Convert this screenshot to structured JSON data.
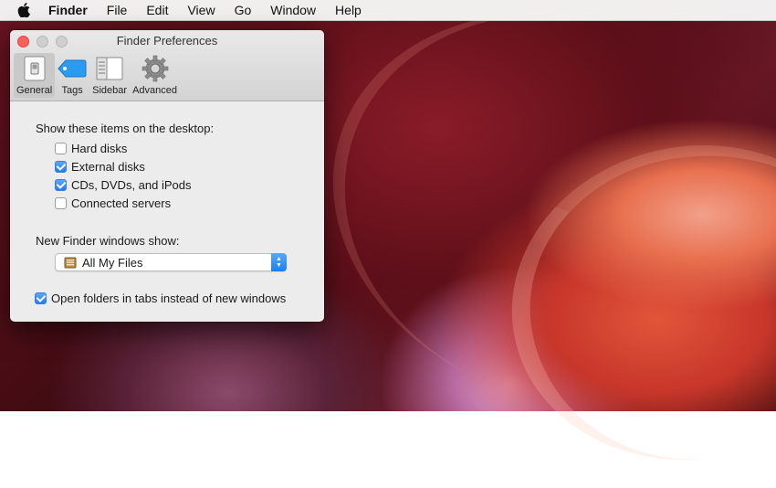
{
  "menubar": {
    "app_name": "Finder",
    "items": [
      "File",
      "Edit",
      "View",
      "Go",
      "Window",
      "Help"
    ]
  },
  "window": {
    "title": "Finder Preferences",
    "tabs": [
      {
        "label": "General",
        "icon": "general-switch-icon",
        "selected": true
      },
      {
        "label": "Tags",
        "icon": "tag-icon",
        "selected": false
      },
      {
        "label": "Sidebar",
        "icon": "sidebar-icon",
        "selected": false
      },
      {
        "label": "Advanced",
        "icon": "gear-icon",
        "selected": false
      }
    ]
  },
  "general": {
    "desktop_heading": "Show these items on the desktop:",
    "desktop_items": [
      {
        "label": "Hard disks",
        "checked": false
      },
      {
        "label": "External disks",
        "checked": true
      },
      {
        "label": "CDs, DVDs, and iPods",
        "checked": true
      },
      {
        "label": "Connected servers",
        "checked": false
      }
    ],
    "new_window_label": "New Finder windows show:",
    "new_window_value": "All My Files",
    "tabs_option": {
      "label": "Open folders in tabs instead of new windows",
      "checked": true
    }
  },
  "colors": {
    "accent": "#1d7ef1",
    "close_button": "#fc605c"
  }
}
